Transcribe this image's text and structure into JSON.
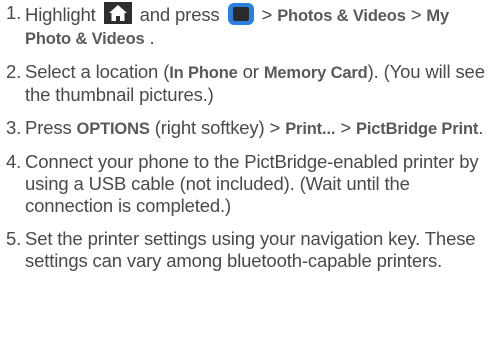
{
  "steps": [
    {
      "num": "1.",
      "t1": "Highlight",
      "t2": "and press",
      "t3": " > ",
      "b1": "Photos & Videos",
      "t4": " > ",
      "b2": "My Photo & Videos",
      "t5": "."
    },
    {
      "num": "2.",
      "t1": "Select a location (",
      "b1": "In Phone",
      "t2": " or ",
      "b2": "Memory Card",
      "t3": "). (You will see the thumbnail pictures.)"
    },
    {
      "num": "3.",
      "t1": "Press ",
      "b1": "OPTIONS",
      "t2": " (right softkey) > ",
      "b2": "Print...",
      "t3": " > ",
      "b3": "PictBridge Print",
      "t4": "."
    },
    {
      "num": "4.",
      "t1": "Connect your phone to the PictBridge-enabled printer by using a USB cable (not included). (Wait until the connection is completed.)"
    },
    {
      "num": "5.",
      "t1": "Set the printer settings using your navigation key. These settings can vary among bluetooth-capable printers."
    }
  ],
  "icons": {
    "home": "home-icon",
    "menu_key": "menu-key-icon",
    "home_bg": "#2e2e2e",
    "menu_key_color": "#2b7fe0"
  }
}
